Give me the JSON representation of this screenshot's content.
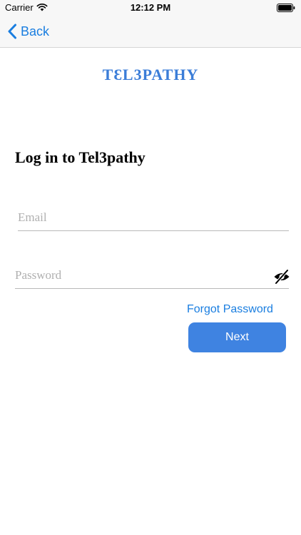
{
  "status_bar": {
    "carrier": "Carrier",
    "time": "12:12 PM",
    "icons": [
      "wifi-icon",
      "battery-icon"
    ]
  },
  "nav": {
    "back_label": "Back",
    "back_icon": "chevron-left-icon"
  },
  "logo": {
    "text": "TƐL3PATHY"
  },
  "login": {
    "heading": "Log in to Tel3pathy",
    "email_placeholder": "Email",
    "email_value": "",
    "password_placeholder": "Password",
    "password_value": "",
    "password_toggle_icon": "eye-slash-icon",
    "forgot_label": "Forgot Password",
    "next_label": "Next"
  },
  "colors": {
    "accent": "#1a7ee0",
    "button": "#3f83e1",
    "logo": "#3b7dd8",
    "bar_background": "#f7f7f7"
  }
}
